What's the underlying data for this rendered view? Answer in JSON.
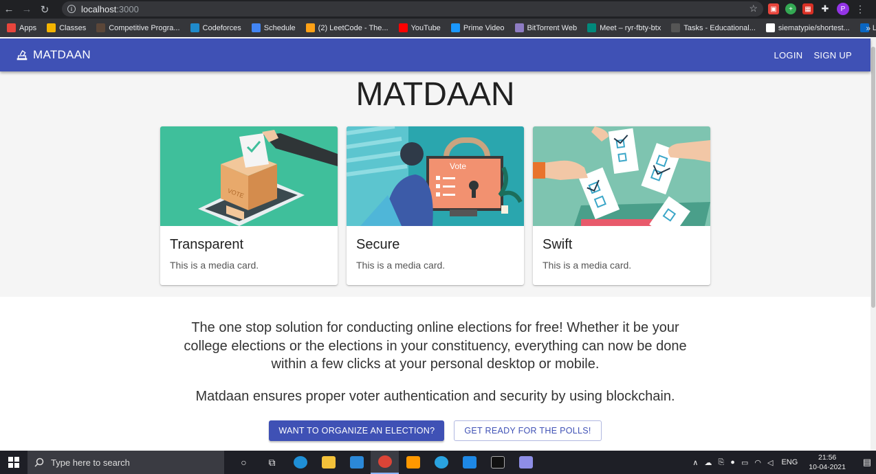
{
  "browser": {
    "url_host": "localhost",
    "url_port": ":3000",
    "bookmarks": [
      {
        "label": "Apps",
        "icon": "apps-grid-icon",
        "color": "#e8453c"
      },
      {
        "label": "Classes",
        "icon": "classroom-icon",
        "color": "#f4b400"
      },
      {
        "label": "Competitive Progra...",
        "icon": "cc-icon",
        "color": "#5b4638"
      },
      {
        "label": "Codeforces",
        "icon": "codeforces-icon",
        "color": "#1f8acb"
      },
      {
        "label": "Schedule",
        "icon": "google-icon",
        "color": "#4285f4"
      },
      {
        "label": "(2) LeetCode - The...",
        "icon": "leetcode-icon",
        "color": "#ffa116"
      },
      {
        "label": "YouTube",
        "icon": "youtube-icon",
        "color": "#ff0000"
      },
      {
        "label": "Prime Video",
        "icon": "prime-video-icon",
        "color": "#1a98ff"
      },
      {
        "label": "BitTorrent Web",
        "icon": "bittorrent-icon",
        "color": "#8e7cc3"
      },
      {
        "label": "Meet – ryr-fbty-btx",
        "icon": "meet-icon",
        "color": "#00897b"
      },
      {
        "label": "Tasks - Educational...",
        "icon": "tasks-icon",
        "color": "#555555"
      },
      {
        "label": "siematypie/shortest...",
        "icon": "github-icon",
        "color": "#ffffff"
      },
      {
        "label": "LinkedIn",
        "icon": "linkedin-icon",
        "color": "#0a66c2"
      }
    ],
    "bookmarks_more": "»",
    "profile_initial": "P"
  },
  "app": {
    "brand": "MATDAAN",
    "nav": {
      "login": "LOGIN",
      "signup": "SIGN UP"
    },
    "hero_title": "MATDAAN",
    "cards": [
      {
        "title": "Transparent",
        "text": "This is a media card."
      },
      {
        "title": "Secure",
        "text": "This is a media card.",
        "media_label": "Vote"
      },
      {
        "title": "Swift",
        "text": "This is a media card."
      }
    ],
    "about": {
      "p1": "The one stop solution for conducting online elections for free! Whether it be your college elections or the elections in your constituency, everything can now be done within a few clicks at your personal desktop or mobile.",
      "p2": "Matdaan ensures proper voter authentication and security by using blockchain."
    },
    "buttons": {
      "organize": "WANT TO ORGANIZE AN ELECTION?",
      "polls": "GET READY FOR THE POLLS!"
    },
    "colors": {
      "primary": "#3f51b5",
      "hero_bg": "#f5f5f5"
    }
  },
  "taskbar": {
    "search_placeholder": "Type here to search",
    "language": "ENG",
    "time": "21:56",
    "date": "10-04-2021"
  }
}
